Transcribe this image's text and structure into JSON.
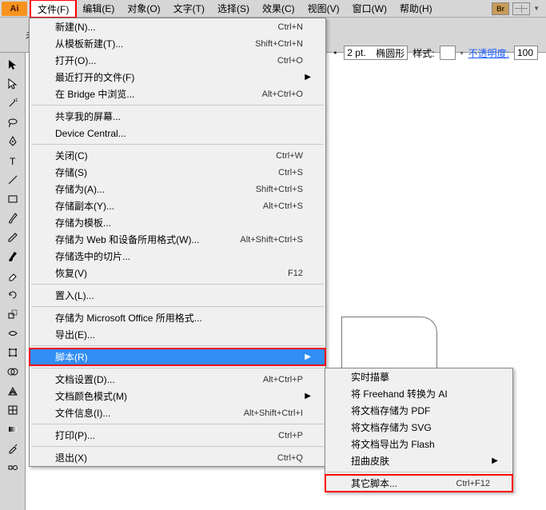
{
  "app_logo": "Ai",
  "menubar": {
    "items": [
      "文件(F)",
      "编辑(E)",
      "对象(O)",
      "文字(T)",
      "选择(S)",
      "效果(C)",
      "视图(V)",
      "窗口(W)",
      "帮助(H)"
    ],
    "open_index": 0,
    "br_badge": "Br"
  },
  "toolbar2": {
    "left_label": "未选",
    "stroke_width": "2 pt.",
    "stroke_style": "椭圆形",
    "style_label": "样式:",
    "opacity_label": "不透明度:",
    "opacity_value": "100"
  },
  "dropdown": [
    {
      "type": "item",
      "label": "新建(N)...",
      "shortcut": "Ctrl+N"
    },
    {
      "type": "item",
      "label": "从模板新建(T)...",
      "shortcut": "Shift+Ctrl+N"
    },
    {
      "type": "item",
      "label": "打开(O)...",
      "shortcut": "Ctrl+O"
    },
    {
      "type": "item",
      "label": "最近打开的文件(F)",
      "shortcut": "",
      "submenu": true
    },
    {
      "type": "item",
      "label": "在 Bridge 中浏览...",
      "shortcut": "Alt+Ctrl+O"
    },
    {
      "type": "sep"
    },
    {
      "type": "item",
      "label": "共享我的屏幕...",
      "shortcut": ""
    },
    {
      "type": "item",
      "label": "Device Central...",
      "shortcut": ""
    },
    {
      "type": "sep"
    },
    {
      "type": "item",
      "label": "关闭(C)",
      "shortcut": "Ctrl+W"
    },
    {
      "type": "item",
      "label": "存储(S)",
      "shortcut": "Ctrl+S"
    },
    {
      "type": "item",
      "label": "存储为(A)...",
      "shortcut": "Shift+Ctrl+S"
    },
    {
      "type": "item",
      "label": "存储副本(Y)...",
      "shortcut": "Alt+Ctrl+S"
    },
    {
      "type": "item",
      "label": "存储为模板...",
      "shortcut": ""
    },
    {
      "type": "item",
      "label": "存储为 Web 和设备所用格式(W)...",
      "shortcut": "Alt+Shift+Ctrl+S"
    },
    {
      "type": "item",
      "label": "存储选中的切片...",
      "shortcut": ""
    },
    {
      "type": "item",
      "label": "恢复(V)",
      "shortcut": "F12"
    },
    {
      "type": "sep"
    },
    {
      "type": "item",
      "label": "置入(L)...",
      "shortcut": ""
    },
    {
      "type": "sep"
    },
    {
      "type": "item",
      "label": "存储为 Microsoft Office 所用格式...",
      "shortcut": ""
    },
    {
      "type": "item",
      "label": "导出(E)...",
      "shortcut": ""
    },
    {
      "type": "sep"
    },
    {
      "type": "item",
      "label": "脚本(R)",
      "shortcut": "",
      "submenu": true,
      "highlight": true,
      "red": true
    },
    {
      "type": "sep"
    },
    {
      "type": "item",
      "label": "文档设置(D)...",
      "shortcut": "Alt+Ctrl+P"
    },
    {
      "type": "item",
      "label": "文档颜色模式(M)",
      "shortcut": "",
      "submenu": true
    },
    {
      "type": "item",
      "label": "文件信息(I)...",
      "shortcut": "Alt+Shift+Ctrl+I"
    },
    {
      "type": "sep"
    },
    {
      "type": "item",
      "label": "打印(P)...",
      "shortcut": "Ctrl+P"
    },
    {
      "type": "sep"
    },
    {
      "type": "item",
      "label": "退出(X)",
      "shortcut": "Ctrl+Q"
    }
  ],
  "submenu": [
    {
      "type": "item",
      "label": "实时描摹",
      "shortcut": ""
    },
    {
      "type": "item",
      "label": "将 Freehand 转换为 AI",
      "shortcut": ""
    },
    {
      "type": "item",
      "label": "将文档存储为 PDF",
      "shortcut": ""
    },
    {
      "type": "item",
      "label": "将文档存储为 SVG",
      "shortcut": ""
    },
    {
      "type": "item",
      "label": "将文档导出为 Flash",
      "shortcut": ""
    },
    {
      "type": "item",
      "label": "扭曲皮肤",
      "shortcut": "",
      "submenu": true
    },
    {
      "type": "sep"
    },
    {
      "type": "item",
      "label": "其它脚本...",
      "shortcut": "Ctrl+F12",
      "red": true
    }
  ]
}
